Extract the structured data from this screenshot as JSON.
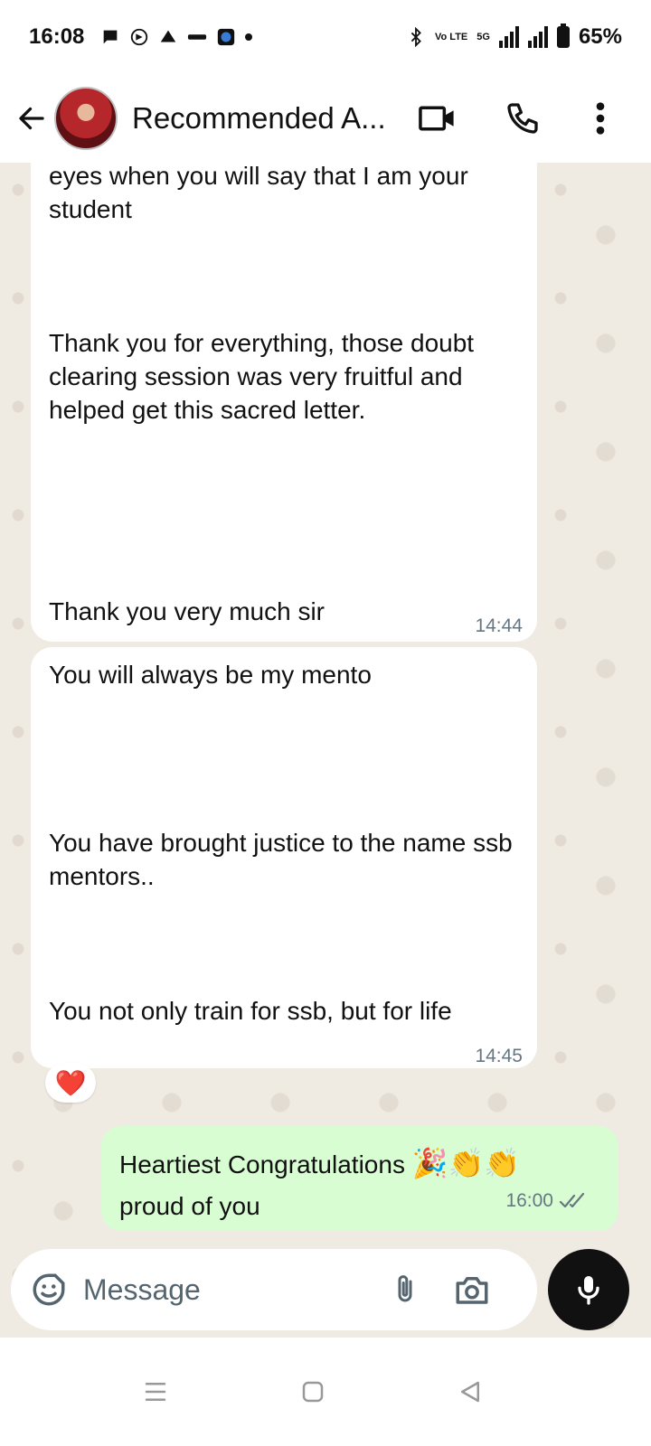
{
  "status_bar": {
    "time": "16:08",
    "left_icons": [
      "message-icon",
      "whatsapp-icon",
      "app-icon",
      "zomato-icon",
      "shield-app-icon",
      "dot-icon"
    ],
    "volte": "Vo LTE",
    "network": "5G",
    "battery": "65%"
  },
  "header": {
    "contact_name": "Recommended A...",
    "back_icon": "back-arrow-icon",
    "video_icon": "video-call-icon",
    "call_icon": "phone-icon",
    "menu_icon": "more-vert-icon"
  },
  "messages": [
    {
      "direction": "incoming",
      "paragraphs": [
        "eyes when you will say that I am your student",
        "Thank you for everything, those doubt clearing session was very fruitful and helped get this sacred letter.",
        "Thank you very much sir"
      ],
      "time": "14:44"
    },
    {
      "direction": "incoming",
      "paragraphs": [
        "You will always be my mento",
        "You have brought justice to the name ssb mentors..",
        "You not only train for ssb, but for life"
      ],
      "time": "14:45",
      "reaction": "❤️"
    },
    {
      "direction": "outgoing",
      "line1": "Heartiest Congratulations",
      "emojis": "🎉👏👏",
      "line2": "proud of you",
      "time": "16:00",
      "status_icon": "double-check-icon"
    }
  ],
  "composer": {
    "placeholder": "Message",
    "sticker_icon": "sticker-icon",
    "attach_icon": "paperclip-icon",
    "camera_icon": "camera-icon",
    "mic_icon": "mic-icon"
  },
  "navbar": {
    "icons": [
      "recents-icon",
      "home-icon",
      "back-icon"
    ]
  }
}
